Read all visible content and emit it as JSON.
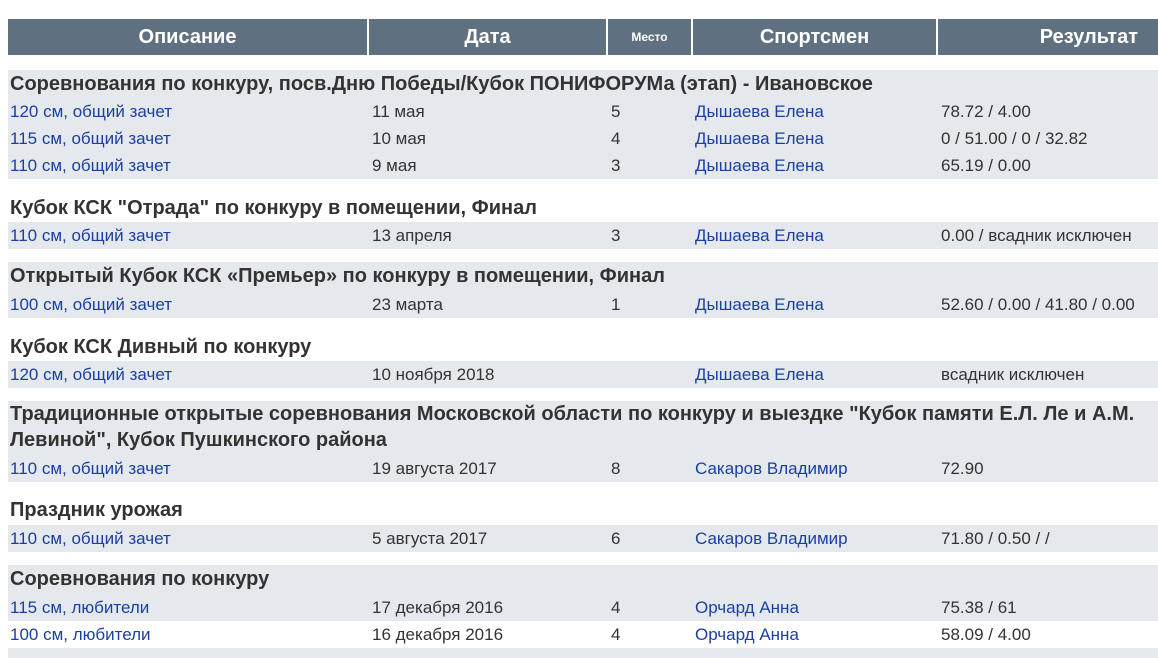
{
  "header": {
    "description": "Описание",
    "date": "Дата",
    "place": "Место",
    "athlete": "Спортсмен",
    "result": "Результат"
  },
  "groups": [
    {
      "title": "Соревнования по конкуру, посв.Дню Победы/Кубок ПОНИФОРУМа (этап) - Ивановское",
      "rows": [
        {
          "desc": "120 см, общий зачет",
          "date": "11 мая",
          "place": "5",
          "athlete": "Дышаева Елена",
          "result": "78.72 / 4.00"
        },
        {
          "desc": "115 см, общий зачет",
          "date": "10 мая",
          "place": "4",
          "athlete": "Дышаева Елена",
          "result": "0 / 51.00 / 0 / 32.82"
        },
        {
          "desc": "110 см, общий зачет",
          "date": "9 мая",
          "place": "3",
          "athlete": "Дышаева Елена",
          "result": "65.19 / 0.00"
        }
      ]
    },
    {
      "title": "Кубок КСК \"Отрада\" по конкуру в помещении, Финал",
      "rows": [
        {
          "desc": "110 см, общий зачет",
          "date": "13 апреля",
          "place": "3",
          "athlete": "Дышаева Елена",
          "result": "0.00 / всадник исключен"
        }
      ]
    },
    {
      "title": "Открытый Кубок КСК «Премьер» по конкуру в помещении, Финал",
      "rows": [
        {
          "desc": "100 см, общий зачет",
          "date": "23 марта",
          "place": "1",
          "athlete": "Дышаева Елена",
          "result": "52.60 / 0.00 / 41.80 / 0.00"
        }
      ]
    },
    {
      "title": "Кубок КСК Дивный по конкуру",
      "rows": [
        {
          "desc": "120 см, общий зачет",
          "date": "10 ноября 2018",
          "place": "",
          "athlete": "Дышаева Елена",
          "result": "всадник исключен"
        }
      ]
    },
    {
      "title": "Традиционные открытые соревнования Московской области по конкуру и выездке \"Кубок памяти Е.Л. Ле и А.М. Левиной\", Кубок Пушкинского района",
      "rows": [
        {
          "desc": "110 см, общий зачет",
          "date": "19 августа 2017",
          "place": "8",
          "athlete": "Сакаров Владимир",
          "result": "72.90"
        }
      ]
    },
    {
      "title": "Праздник урожая",
      "rows": [
        {
          "desc": "110 см, общий зачет",
          "date": "5 августа 2017",
          "place": "6",
          "athlete": "Сакаров Владимир",
          "result": "71.80 / 0.50 / /"
        }
      ]
    },
    {
      "title": "Соревнования по конкуру",
      "rows": [
        {
          "desc": "115 см, любители",
          "date": "17 декабря 2016",
          "place": "4",
          "athlete": "Орчард Анна",
          "result": "75.38 / 61"
        },
        {
          "desc": "100 см, любители",
          "date": "16 декабря 2016",
          "place": "4",
          "athlete": "Орчард Анна",
          "result": "58.09 / 4.00"
        }
      ]
    }
  ]
}
